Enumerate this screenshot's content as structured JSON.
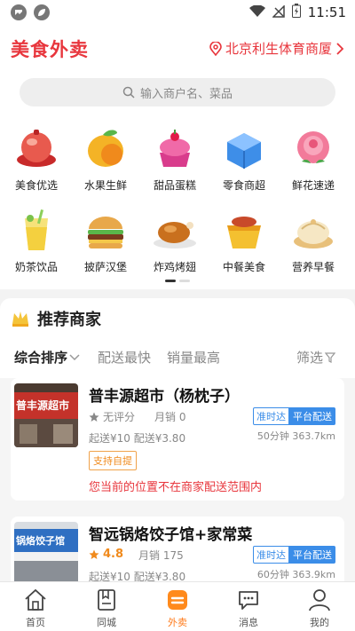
{
  "status_bar": {
    "time": "11:51"
  },
  "header": {
    "app_title": "美食外卖",
    "location": "北京利生体育商厦"
  },
  "search": {
    "placeholder": "输入商户名、菜品"
  },
  "categories": [
    {
      "label": "美食优选",
      "icon": "food-bowl-icon"
    },
    {
      "label": "水果生鲜",
      "icon": "mango-icon"
    },
    {
      "label": "甜品蛋糕",
      "icon": "cake-icon"
    },
    {
      "label": "零食商超",
      "icon": "box-icon"
    },
    {
      "label": "鲜花速递",
      "icon": "rose-icon"
    },
    {
      "label": "奶茶饮品",
      "icon": "milk-tea-icon"
    },
    {
      "label": "披萨汉堡",
      "icon": "burger-icon"
    },
    {
      "label": "炸鸡烤翅",
      "icon": "roast-chicken-icon"
    },
    {
      "label": "中餐美食",
      "icon": "chinese-food-icon"
    },
    {
      "label": "营养早餐",
      "icon": "dumpling-icon"
    }
  ],
  "recommend": {
    "title": "推荐商家",
    "sort": {
      "comprehensive": "综合排序",
      "fastest": "配送最快",
      "top_sales": "销量最高",
      "filter": "筛选"
    }
  },
  "stores": [
    {
      "name": "普丰源超市（杨枕子）",
      "rating_text": "无评分",
      "sales": "月销 0",
      "fee": "起送¥10  配送¥3.80",
      "distance": "50分钟 363.7km",
      "tag_ontime": "准时达",
      "tag_platform": "平台配送",
      "pickup": "支持自提",
      "warning": "您当前的位置不在商家配送范围内",
      "thumb_text": "普丰源超市"
    },
    {
      "name": "智远锅烙饺子馆+家常菜",
      "rating_score": "4.8",
      "sales": "月销 175",
      "fee": "起送¥10  配送¥3.80",
      "distance": "60分钟 363.9km",
      "tag_ontime": "准时达",
      "tag_platform": "平台配送",
      "thumb_text": "锅烙饺子馆"
    }
  ],
  "tabbar": [
    {
      "label": "首页"
    },
    {
      "label": "同城"
    },
    {
      "label": "外卖"
    },
    {
      "label": "消息"
    },
    {
      "label": "我的"
    }
  ],
  "colors": {
    "brand_red": "#e8363d",
    "active_tab": "#ff7a1a",
    "platform_blue": "#3b8de8",
    "rating_orange": "#f08a1c"
  }
}
